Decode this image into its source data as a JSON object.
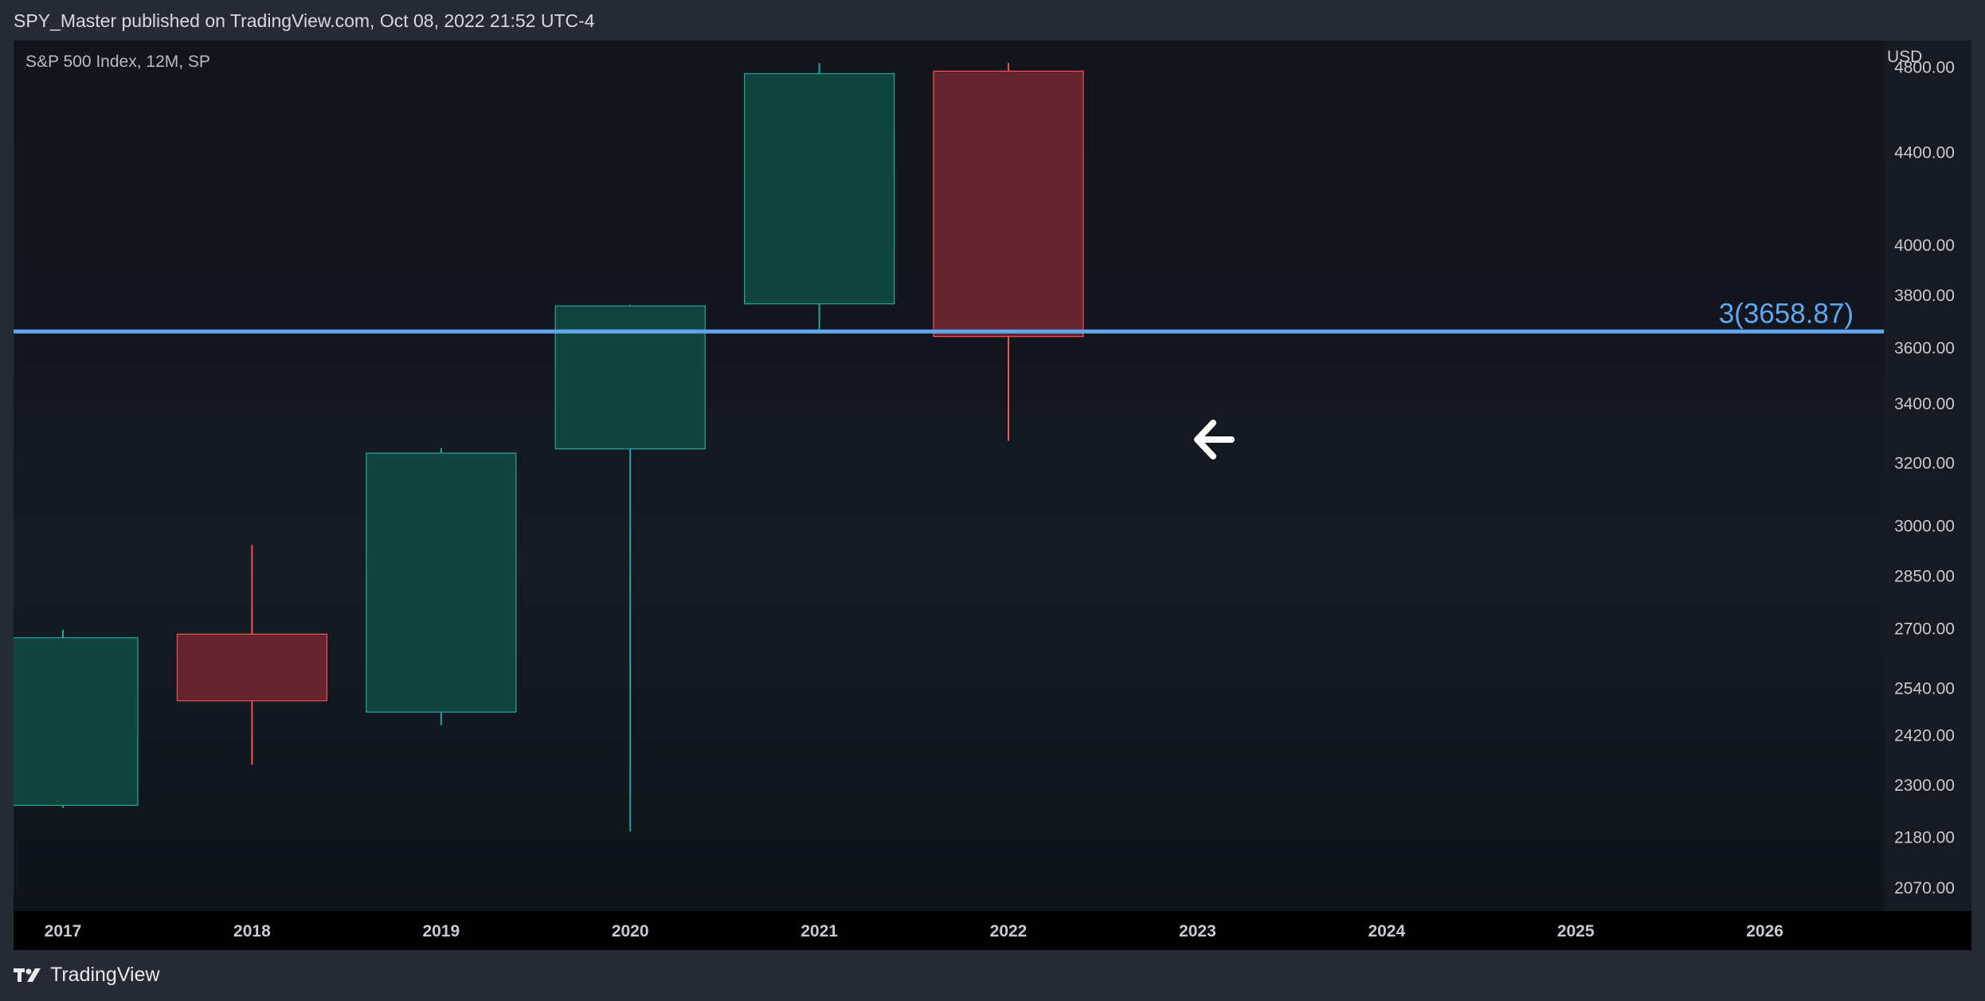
{
  "header": {
    "published": "SPY_Master published on TradingView.com, Oct 08, 2022 21:52 UTC-4"
  },
  "footer": {
    "brand": "TradingView",
    "logo_icon": "tradingview-logo-icon"
  },
  "chart_data": {
    "type": "candlestick",
    "title": "S&P 500 Index, 12M, SP",
    "y_unit": "USD",
    "y_scale": "log",
    "ylim": [
      2020,
      4930
    ],
    "x_labels": [
      "2017",
      "2018",
      "2019",
      "2020",
      "2021",
      "2022",
      "2023",
      "2024",
      "2025",
      "2026"
    ],
    "y_ticks": [
      "4800.00",
      "4400.00",
      "4000.00",
      "3800.00",
      "3600.00",
      "3400.00",
      "3200.00",
      "3000.00",
      "2850.00",
      "2700.00",
      "2540.00",
      "2420.00",
      "2300.00",
      "2180.00",
      "2070.00"
    ],
    "candles": [
      {
        "year": "2017",
        "open": 2251,
        "high": 2695,
        "low": 2245,
        "close": 2673
      },
      {
        "year": "2018",
        "open": 2683,
        "high": 2940,
        "low": 2347,
        "close": 2506
      },
      {
        "year": "2019",
        "open": 2477,
        "high": 3247,
        "low": 2444,
        "close": 3230
      },
      {
        "year": "2020",
        "open": 3244,
        "high": 3760,
        "low": 2192,
        "close": 3756
      },
      {
        "year": "2021",
        "open": 3764,
        "high": 4818,
        "low": 3663,
        "close": 4766
      },
      {
        "year": "2022",
        "open": 4778,
        "high": 4818,
        "low": 3271,
        "close": 3640
      }
    ],
    "hline": {
      "value": 3658.87,
      "label": "3(3658.87)",
      "color": "#5fa8ef"
    },
    "colors": {
      "up_fill": "#12443f",
      "up_border": "#26a69a",
      "down_fill": "#652430",
      "down_border": "#ef5350",
      "background_top": "#12151c",
      "background_bottom": "#0f131a",
      "axis_bg": "#000000",
      "axis_text": "#c8cad0"
    },
    "annotation": {
      "icon": "arrow-left-icon",
      "color": "#ffffff"
    },
    "grid": false
  }
}
